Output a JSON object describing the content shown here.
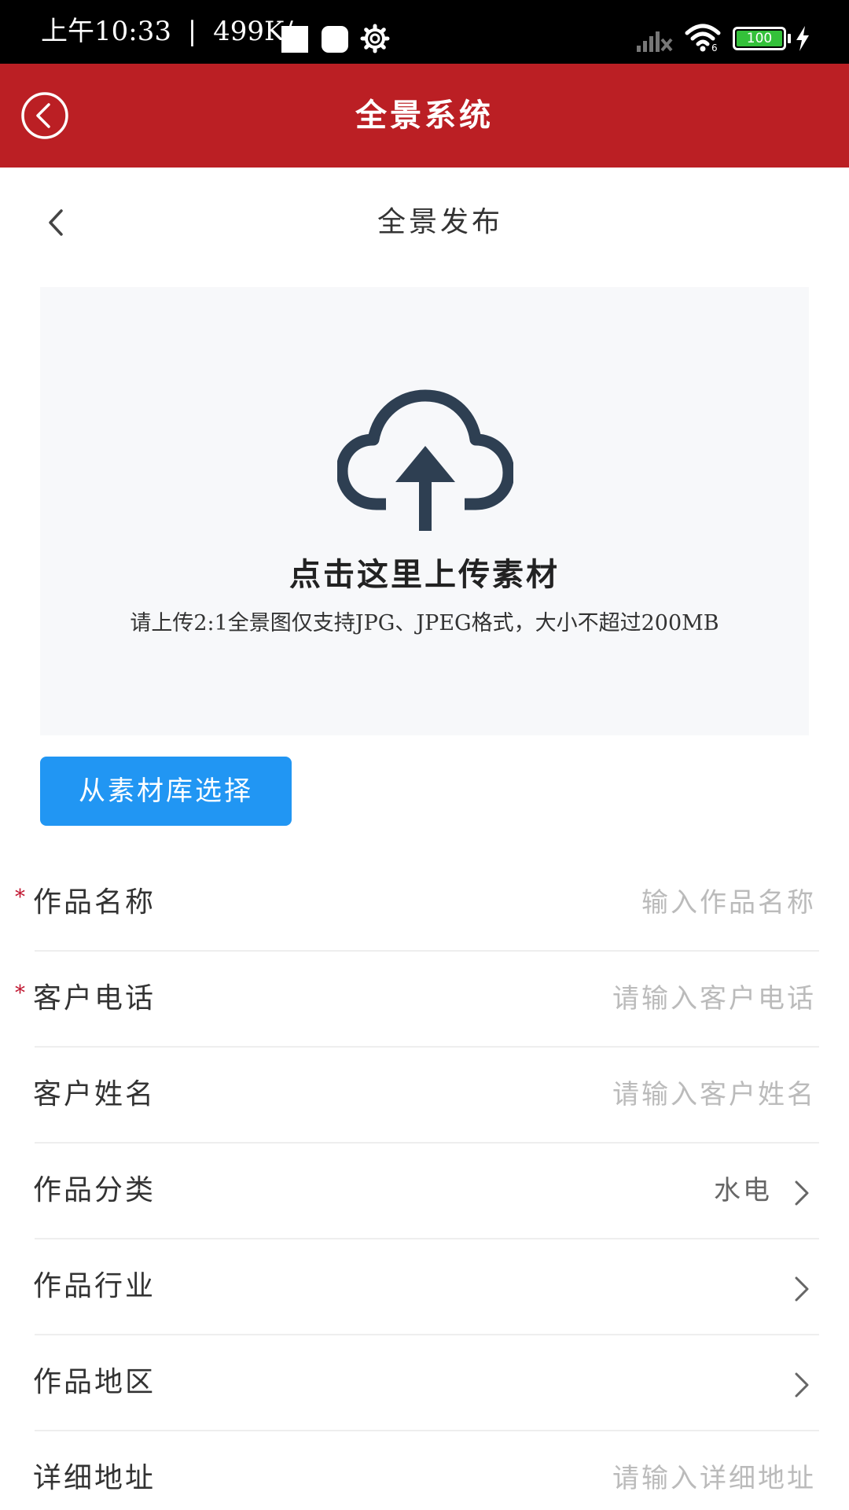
{
  "status_bar": {
    "time": "上午10:33",
    "separator": "|",
    "speed": "499K/s",
    "wifi_badge": "6",
    "battery": "100",
    "icons": [
      "square-icon",
      "rounded-square-icon",
      "gear-icon",
      "signal-icon",
      "wifi-icon",
      "battery-icon",
      "charging-bolt-icon"
    ]
  },
  "titlebar": {
    "title": "全景系统",
    "back_icon": "circle-back-icon",
    "color": "#bb1f24"
  },
  "subheader": {
    "title": "全景发布",
    "back_icon": "chevron-left-icon"
  },
  "upload": {
    "icon": "cloud-upload-icon",
    "title": "点击这里上传素材",
    "hint": "请上传2:1全景图仅支持JPG、JPEG格式，大小不超过200MB"
  },
  "library_button": {
    "label": "从素材库选择",
    "color": "#2196f3"
  },
  "form": {
    "required_mark": "*",
    "rows": [
      {
        "label": "作品名称",
        "required": true,
        "placeholder": "输入作品名称"
      },
      {
        "label": "客户电话",
        "required": true,
        "placeholder": "请输入客户电话"
      },
      {
        "label": "客户姓名",
        "required": false,
        "placeholder": "请输入客户姓名"
      },
      {
        "label": "作品分类",
        "value": "水电",
        "type": "select"
      },
      {
        "label": "作品行业",
        "value": "",
        "type": "select"
      },
      {
        "label": "作品地区",
        "value": "",
        "type": "select"
      },
      {
        "label": "详细地址",
        "required": false,
        "placeholder": "请输入详细地址"
      }
    ]
  }
}
